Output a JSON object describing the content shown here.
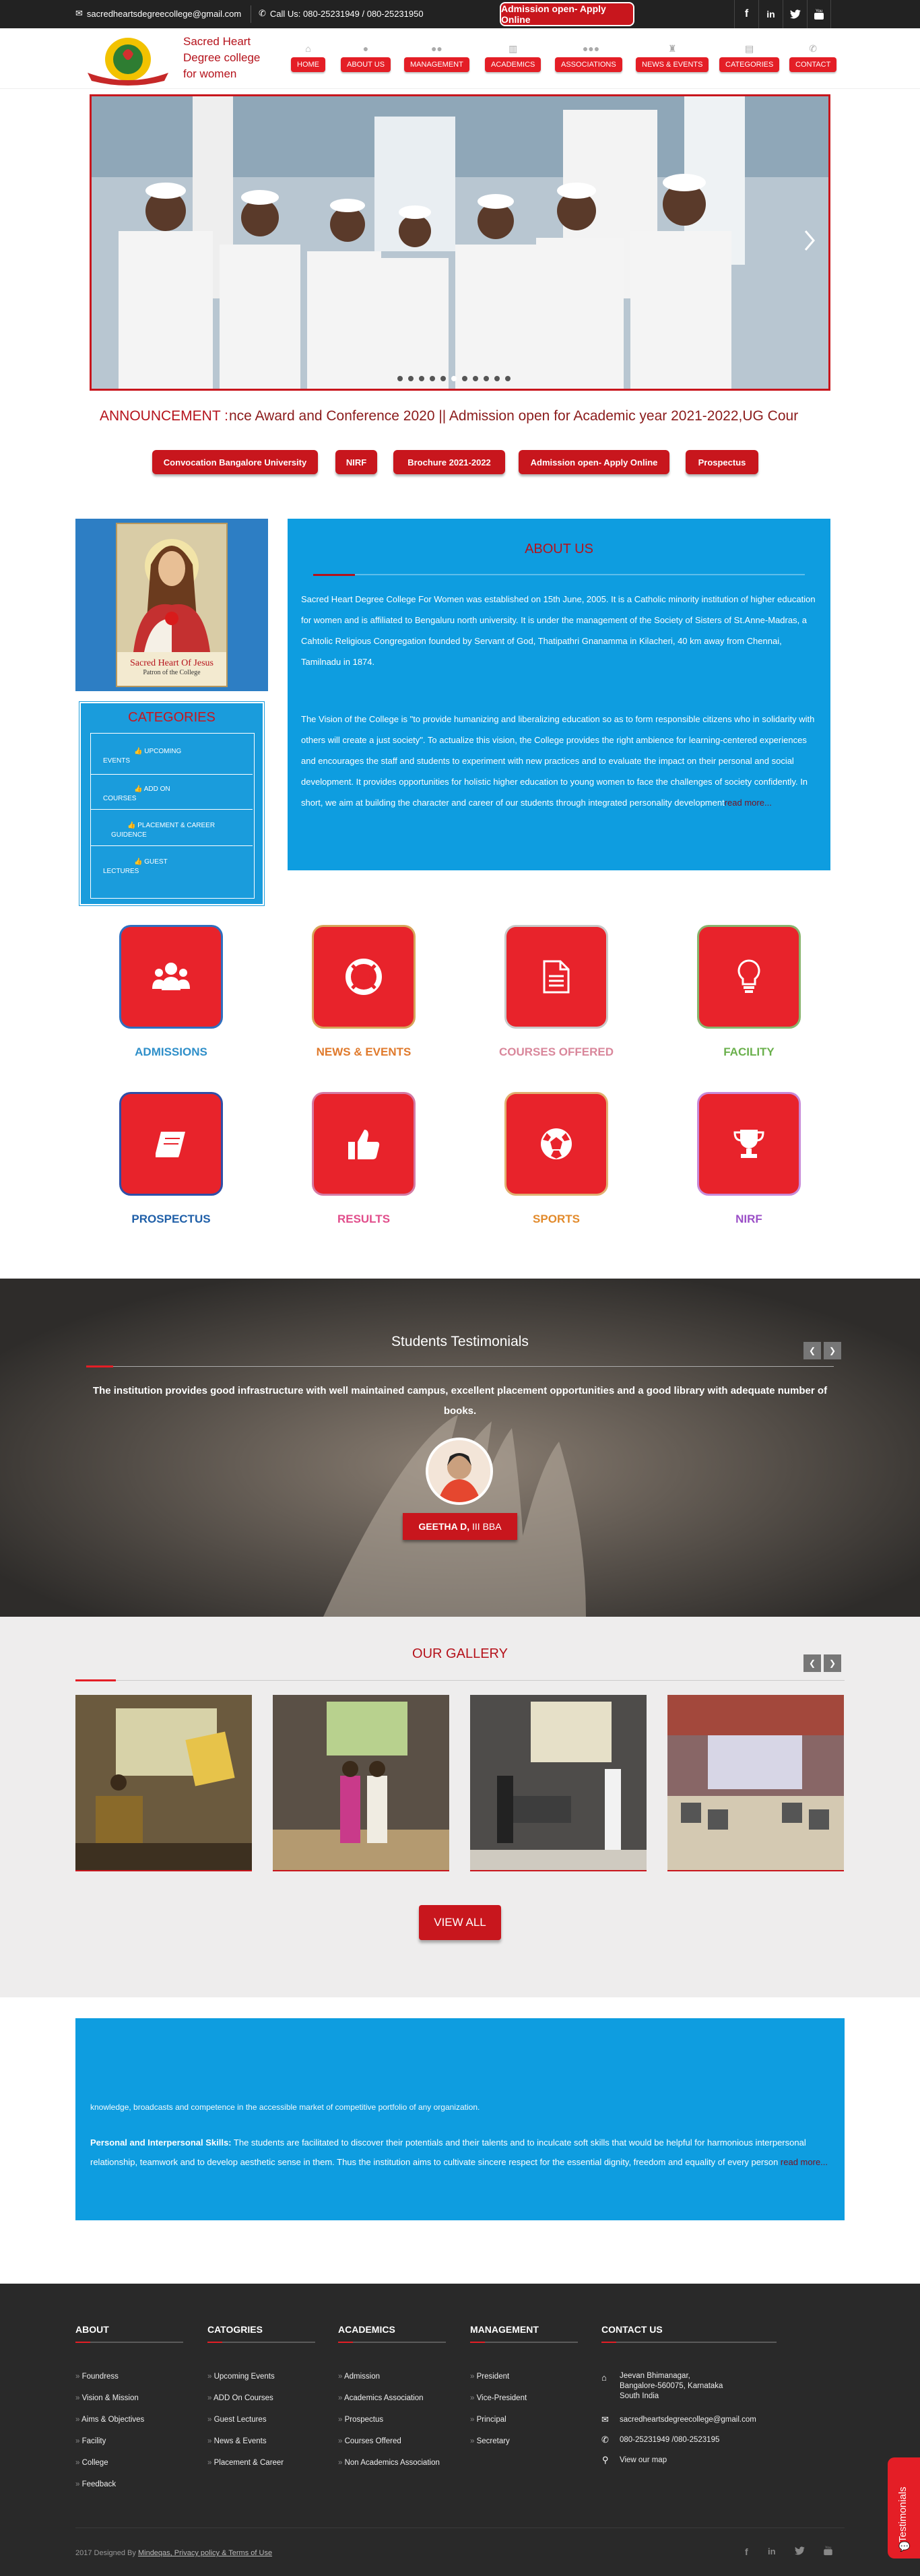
{
  "topbar": {
    "email": "sacredheartsdegreecollege@gmail.com",
    "phone": "Call Us: 080-25231949 / 080-25231950",
    "apply_button": "Admission open- Apply Online"
  },
  "header": {
    "college_name_line1": "Sacred Heart",
    "college_name_line2": "Degree college",
    "college_name_line3": "for women",
    "nav": [
      {
        "label": "HOME",
        "icon": "home-icon"
      },
      {
        "label": "ABOUT US",
        "icon": "user-icon"
      },
      {
        "label": "MANAGEMENT",
        "icon": "users-icon"
      },
      {
        "label": "ACADEMICS",
        "icon": "chart-icon"
      },
      {
        "label": "ASSOCIATIONS",
        "icon": "group-icon"
      },
      {
        "label": "NEWS & EVENTS",
        "icon": "trophy-icon"
      },
      {
        "label": "CATEGORIES",
        "icon": "document-icon"
      },
      {
        "label": "CONTACT",
        "icon": "phone-icon"
      }
    ]
  },
  "announcement": {
    "label": "ANNOUNCEMENT :",
    "text": "nce Award and Conference 2020 || Admission open for Academic year 2021-2022,UG Cour"
  },
  "quick_links": [
    "Convocation Bangalore University",
    "NIRF",
    "Brochure 2021-2022",
    "Admission open- Apply Online",
    "Prospectus"
  ],
  "jesus": {
    "caption1": "Sacred Heart Of Jesus",
    "caption2": "Patron of the College"
  },
  "categories": {
    "title": "CATEGORIES",
    "items": [
      "UPCOMING EVENTS",
      "ADD ON COURSES",
      "PLACEMENT & CAREER GUIDENCE",
      "GUEST LECTURES"
    ]
  },
  "about": {
    "title": "ABOUT US",
    "para1": "Sacred Heart Degree College For Women was established on 15th June, 2005. It is a Catholic minority institution of higher education for women and is affiliated to Bengaluru north university. It is under the management of the Society of Sisters of St.Anne-Madras, a Cahtolic Religious Congregation founded by Servant of God, Thatipathri Gnanamma in Kilacheri, 40 km away from Chennai, Tamilnadu in 1874.",
    "para2": "The Vision of the College is \"to provide humanizing and liberalizing education so as to form responsible citizens who in solidarity with others will create a just society\". To actualize this vision, the College provides the right ambience for learning-centered experiences and encourages the staff and students to experiment with new practices and to evaluate the impact on their personal and social development. It provides opportunities for holistic higher education to young women to face the challenges of society confidently. In short, we aim at building the character and career of our students through integrated personality development",
    "read_more": "read more..."
  },
  "services": [
    {
      "label": "ADMISSIONS",
      "icon": "users-icon",
      "color": "#2f8fc9"
    },
    {
      "label": "NEWS & EVENTS",
      "icon": "lifebuoy-icon",
      "color": "#e07a2c"
    },
    {
      "label": "COURSES OFFERED",
      "icon": "document-icon",
      "color": "#d9879b"
    },
    {
      "label": "FACILITY",
      "icon": "lightbulb-icon",
      "color": "#6ab04c"
    },
    {
      "label": "PROSPECTUS",
      "icon": "book-icon",
      "color": "#1f5fa8"
    },
    {
      "label": "RESULTS",
      "icon": "thumbs-up-icon",
      "color": "#e14d8b"
    },
    {
      "label": "SPORTS",
      "icon": "football-icon",
      "color": "#e28a2b"
    },
    {
      "label": "NIRF",
      "icon": "trophy-icon",
      "color": "#9b4fc7"
    }
  ],
  "testimonials": {
    "title": "Students Testimonials",
    "quote": "The institution provides good infrastructure with well maintained campus, excellent placement opportunities and a good library with adequate number of books.",
    "name": "GEETHA D,",
    "course": "III BBA"
  },
  "gallery": {
    "title": "OUR GALLERY",
    "view_all": "VIEW ALL"
  },
  "objectives": {
    "line1": "knowledge, broadcasts and competence in the accessible market of competitive portfolio of any organization.",
    "heading": "Personal and Interpersonal Skills:",
    "text": "The students are facilitated to discover their potentials and their talents and to inculcate soft skills that would be helpful for harmonious interpersonal relationship, teamwork and to develop aesthetic sense in them. Thus the institution aims to cultivate sincere respect for the essential dignity, freedom and equality of every person",
    "read_more": "read more..."
  },
  "footer": {
    "about": {
      "title": "ABOUT",
      "links": [
        "Foundress",
        "Vision & Mission",
        "Aims & Objectives",
        "Facility",
        "College",
        "Feedback"
      ]
    },
    "categories": {
      "title": "CATOGRIES",
      "links": [
        "Upcoming Events",
        "ADD On Courses",
        "Guest Lectures",
        "News & Events",
        "Placement & Career"
      ]
    },
    "academics": {
      "title": "ACADEMICS",
      "links": [
        "Admission",
        "Academics Association",
        "Prospectus",
        "Courses Offered",
        "Non Academics Association"
      ]
    },
    "management": {
      "title": "MANAGEMENT",
      "links": [
        "President",
        "Vice-President",
        "Principal",
        "Secretary"
      ]
    },
    "contact": {
      "title": "CONTACT US",
      "address1": "Jeevan Bhimanagar,",
      "address2": "Bangalore-560075, Karnataka",
      "address3": "South India",
      "email": "sacredheartsdegreecollege@gmail.com",
      "phone": "080-25231949 /080-2523195",
      "map": "View our map"
    },
    "copyright_prefix": "2017 Designed By",
    "copyright_link": "Mindeqas, Privacy policy & Terms of Use",
    "testimonials_tab": "Testimonials"
  }
}
